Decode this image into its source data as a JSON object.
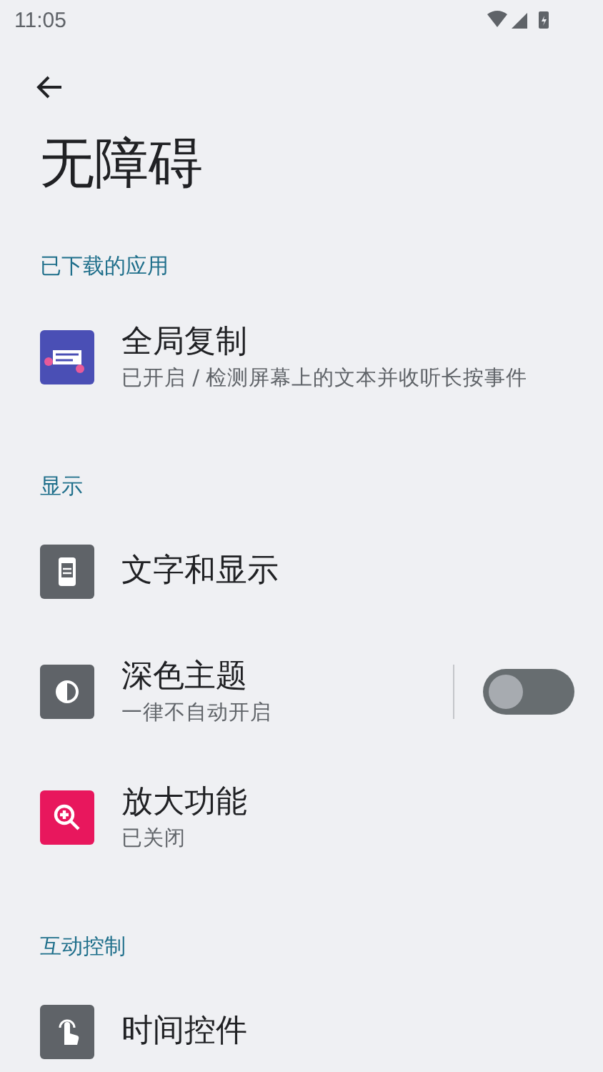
{
  "status_bar": {
    "time": "11:05"
  },
  "title": "无障碍",
  "sections": [
    {
      "title": "已下载的应用",
      "items": [
        {
          "kind": "copy",
          "color": "#4a4fb5",
          "title": "全局复制",
          "summary": "已开启 / 检测屏幕上的文本并收听长按事件"
        }
      ]
    },
    {
      "title": "显示",
      "items": [
        {
          "kind": "display",
          "color": "#5f6368",
          "title": "文字和显示"
        },
        {
          "kind": "contrast",
          "color": "#5f6368",
          "title": "深色主题",
          "summary": "一律不自动开启",
          "toggle": {
            "on": false
          }
        },
        {
          "kind": "magnify",
          "color": "#e8175d",
          "title": "放大功能",
          "summary": "已关闭"
        }
      ]
    },
    {
      "title": "互动控制",
      "items": [
        {
          "kind": "touch",
          "color": "#5f6368",
          "title": "时间控件"
        }
      ]
    }
  ]
}
